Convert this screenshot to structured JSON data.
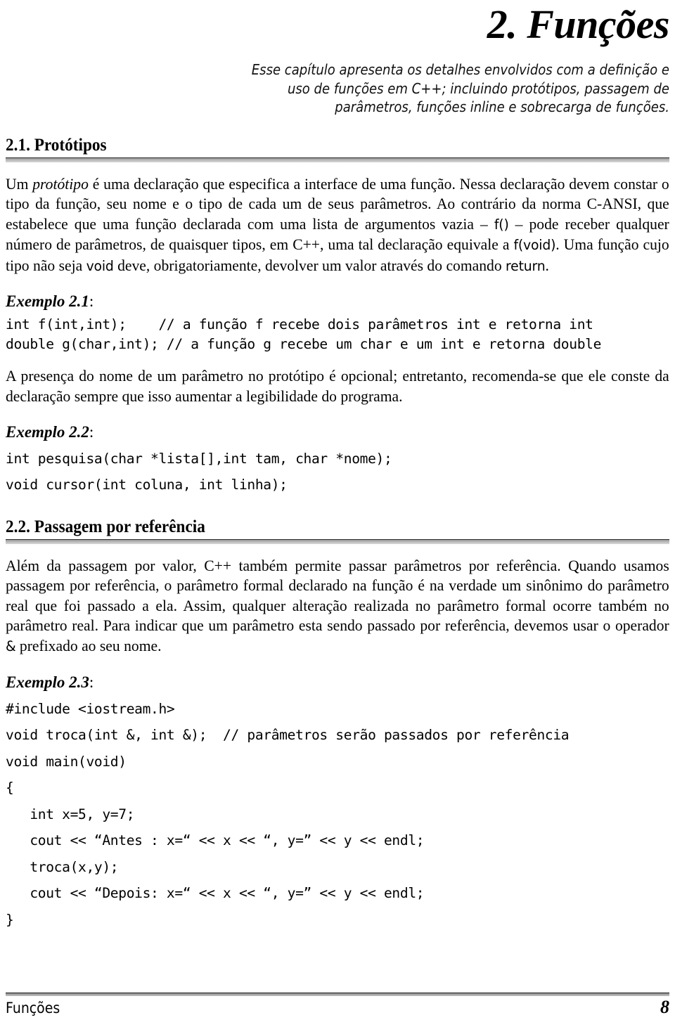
{
  "document": {
    "chapter_title": "2. Funções",
    "abstract_lines": [
      "Esse capítulo apresenta os detalhes envolvidos com a definição e",
      "uso de funções em C++; incluindo protótipos, passagem de",
      "parâmetros, funções inline e sobrecarga de funções."
    ]
  },
  "sections": {
    "prototipos": {
      "heading": "2.1. Protótipos",
      "paragraph_1": {
        "p1a": "Um ",
        "p1b_italic": "protótipo",
        "p1c": " é uma declaração que especifica a interface de uma função. Nessa declaração devem constar o tipo da função, seu nome e o tipo de cada um de seus parâmetros. Ao contrário da norma C-ANSI, que estabelece que uma função declarada com uma lista de argumentos vazia – ",
        "p1d_code": "f()",
        "p1e": " – pode receber qualquer número de parâmetros, de quaisquer tipos, em C++, uma tal declaração equivale a ",
        "p1f_code": "f(void)",
        "p1g": ". Uma função cujo tipo não seja ",
        "p1h_code": "void",
        "p1i": " deve, obrigatoriamente, devolver um valor através do comando ",
        "p1j_code": "return",
        "p1k": "."
      },
      "example_1": {
        "name": "Exemplo 2.1",
        "colon": ":",
        "code": "int f(int,int);    // a função f recebe dois parâmetros int e retorna int\ndouble g(char,int); // a função g recebe um char e um int e retorna double"
      },
      "paragraph_2": "A presença do nome de um parâmetro no protótipo é opcional; entretanto, recomenda-se que ele conste da declaração sempre que isso aumentar a legibilidade do programa.",
      "example_2": {
        "name": "Exemplo 2.2",
        "colon": ":",
        "code": "int pesquisa(char *lista[],int tam, char *nome);\nvoid cursor(int coluna, int linha);"
      }
    },
    "passagem_referencia": {
      "heading": "2.2. Passagem por referência",
      "paragraph_1": {
        "p1a": "Além da passagem por valor, C++ também permite passar parâmetros por referência. Quando usamos passagem por referência, o parâmetro formal declarado na função é na verdade um sinônimo do parâmetro real que foi passado a ela. Assim, qualquer alteração realizada no parâmetro formal ocorre também no parâmetro real. Para indicar que um parâmetro esta sendo passado por referência, devemos usar o operador ",
        "p1b_code": "&",
        "p1c": " prefixado ao seu nome."
      },
      "example_3": {
        "name": "Exemplo 2.3",
        "colon": ":",
        "code": "#include <iostream.h>\nvoid troca(int &, int &);  // parâmetros serão passados por referência\nvoid main(void)\n{\n   int x=5, y=7;\n   cout << “Antes : x=“ << x << “, y=” << y << endl;\n   troca(x,y);\n   cout << “Depois: x=“ << x << “, y=” << y << endl;\n}"
      }
    }
  },
  "footer": {
    "left_label": "Funções",
    "page_number": "8"
  },
  "colors": {
    "text": "#000000",
    "rule_dark": "#2b2b2b",
    "rule_light": "#c2c2c2",
    "background": "#ffffff"
  }
}
